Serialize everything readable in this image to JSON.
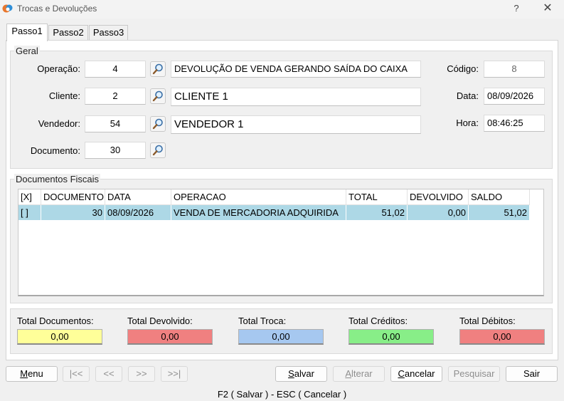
{
  "window": {
    "title": "Trocas e Devoluções",
    "help_label": "?",
    "close_label": "✕"
  },
  "tabs": [
    {
      "label": "Passo1"
    },
    {
      "label": "Passo2"
    },
    {
      "label": "Passo3"
    }
  ],
  "geral": {
    "title": "Geral",
    "operacao": {
      "label": "Operação:",
      "value": "4",
      "description": "DEVOLUÇÃO DE VENDA GERANDO SAÍDA DO CAIXA"
    },
    "cliente": {
      "label": "Cliente:",
      "value": "2",
      "description": "CLIENTE 1"
    },
    "vendedor": {
      "label": "Vendedor:",
      "value": "54",
      "description": "VENDEDOR 1"
    },
    "documento": {
      "label": "Documento:",
      "value": "30"
    },
    "codigo": {
      "label": "Código:",
      "value": "8"
    },
    "data": {
      "label": "Data:",
      "value": "08/09/2026"
    },
    "hora": {
      "label": "Hora:",
      "value": "08:46:25"
    }
  },
  "documentos": {
    "title": "Documentos Fiscais",
    "columns": [
      "[X]",
      "DOCUMENTO",
      "DATA",
      "OPERACAO",
      "TOTAL",
      "DEVOLVIDO",
      "SALDO"
    ],
    "rows": [
      {
        "check": "[ ]",
        "documento": "30",
        "data": "08/09/2026",
        "operacao": "VENDA DE MERCADORIA ADQUIRIDA",
        "total": "51,02",
        "devolvido": "0,00",
        "saldo": "51,02"
      }
    ]
  },
  "totals": [
    {
      "label": "Total Documentos:",
      "value": "0,00",
      "color": "#ffff99"
    },
    {
      "label": "Total Devolvido:",
      "value": "0,00",
      "color": "#f08080"
    },
    {
      "label": "Total Troca:",
      "value": "0,00",
      "color": "#a6c8f0"
    },
    {
      "label": "Total Créditos:",
      "value": "0,00",
      "color": "#88ee88"
    },
    {
      "label": "Total Débitos:",
      "value": "0,00",
      "color": "#f08080"
    }
  ],
  "buttons": {
    "menu": {
      "first": "M",
      "rest": "enu"
    },
    "first": "|<<",
    "prev": "<<",
    "next": ">>",
    "last": ">>|",
    "salvar": {
      "first": "S",
      "rest": "alvar"
    },
    "alterar": {
      "first": "A",
      "rest": "lterar"
    },
    "cancelar": {
      "first": "C",
      "rest": "ancelar"
    },
    "pesquisar": "Pesquisar",
    "sair": "Sair"
  },
  "footer": "F2 ( Salvar )  -  ESC ( Cancelar )"
}
